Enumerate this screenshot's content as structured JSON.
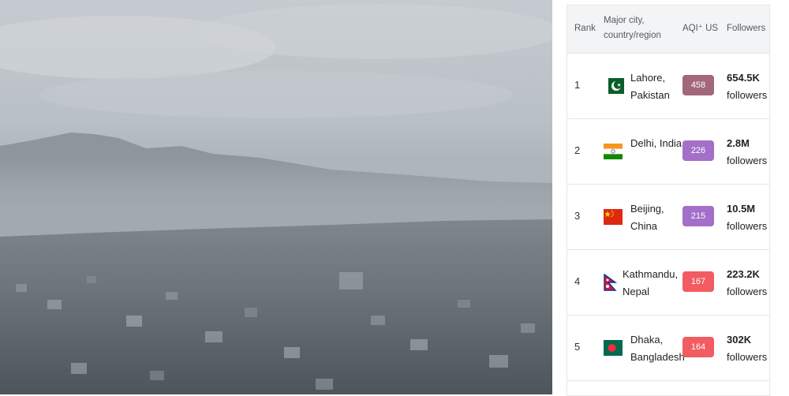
{
  "table": {
    "headers": {
      "rank": "Rank",
      "city": "Major city, country/region",
      "aqi": "AQI⁺ US",
      "followers": "Followers"
    },
    "rows": [
      {
        "rank": "1",
        "city": "Lahore, Pakistan",
        "flag_icon": "pakistan-flag-icon",
        "aqi": "458",
        "aqi_color": "#a3677a",
        "followers": "654.5K",
        "followers_label": "followers"
      },
      {
        "rank": "2",
        "city": "Delhi, India",
        "flag_icon": "india-flag-icon",
        "aqi": "226",
        "aqi_color": "#a36fc8",
        "followers": "2.8M",
        "followers_label": "followers"
      },
      {
        "rank": "3",
        "city": "Beijing, China",
        "flag_icon": "china-flag-icon",
        "aqi": "215",
        "aqi_color": "#a36fc8",
        "followers": "10.5M",
        "followers_label": "followers"
      },
      {
        "rank": "4",
        "city": "Kathmandu, Nepal",
        "flag_icon": "nepal-flag-icon",
        "aqi": "167",
        "aqi_color": "#f25b61",
        "followers": "223.2K",
        "followers_label": "followers"
      },
      {
        "rank": "5",
        "city": "Dhaka, Bangladesh",
        "flag_icon": "bangladesh-flag-icon",
        "aqi": "164",
        "aqi_color": "#f25b61",
        "followers": "302K",
        "followers_label": "followers"
      }
    ]
  }
}
